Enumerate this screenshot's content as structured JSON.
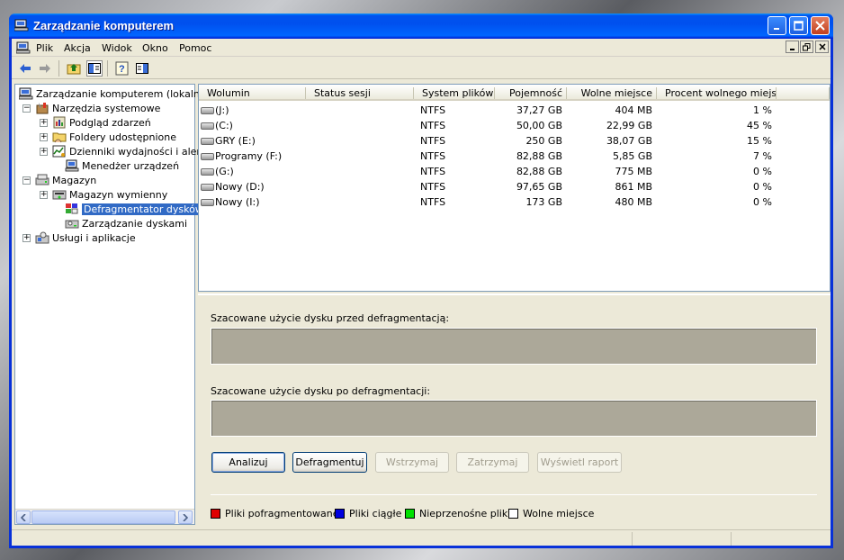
{
  "window": {
    "title": "Zarządzanie komputerem",
    "colors": {
      "titlebar": "#0053ee",
      "selection": "#316ac5",
      "frame": "#ece9d8"
    }
  },
  "menu": {
    "items": [
      "Plik",
      "Akcja",
      "Widok",
      "Okno",
      "Pomoc"
    ]
  },
  "toolbar": {
    "icons": [
      "back-arrow-icon",
      "forward-arrow-icon",
      "up-folder-icon",
      "show-hide-tree-icon",
      "help-icon",
      "export-list-icon"
    ]
  },
  "tree": {
    "root": "Zarządzanie komputerem (lokalne)",
    "nodes": [
      {
        "label": "Narzędzia systemowe",
        "level": 1,
        "expander": "−",
        "icon": "tools-icon"
      },
      {
        "label": "Podgląd zdarzeń",
        "level": 2,
        "expander": "+",
        "icon": "event-viewer-icon"
      },
      {
        "label": "Foldery udostępnione",
        "level": 2,
        "expander": "+",
        "icon": "shared-folder-icon"
      },
      {
        "label": "Dzienniki wydajności i alerty",
        "level": 2,
        "expander": "+",
        "icon": "performance-icon"
      },
      {
        "label": "Menedżer urządzeń",
        "level": 2,
        "expander": "",
        "icon": "device-manager-icon"
      },
      {
        "label": "Magazyn",
        "level": 1,
        "expander": "−",
        "icon": "storage-icon"
      },
      {
        "label": "Magazyn wymienny",
        "level": 2,
        "expander": "+",
        "icon": "removable-storage-icon"
      },
      {
        "label": "Defragmentator dysków",
        "level": 2,
        "expander": "",
        "icon": "defrag-icon",
        "selected": true
      },
      {
        "label": "Zarządzanie dyskami",
        "level": 2,
        "expander": "",
        "icon": "disk-management-icon"
      },
      {
        "label": "Usługi i aplikacje",
        "level": 1,
        "expander": "+",
        "icon": "services-icon"
      }
    ]
  },
  "volumes": {
    "columns": [
      "Wolumin",
      "Status sesji",
      "System plików",
      "Pojemność",
      "Wolne miejsce",
      "Procent wolnego miejsca"
    ],
    "rows": [
      {
        "name": "(J:)",
        "status": "",
        "fs": "NTFS",
        "capacity": "37,27 GB",
        "free": "404 MB",
        "percent": "1 %"
      },
      {
        "name": "(C:)",
        "status": "",
        "fs": "NTFS",
        "capacity": "50,00 GB",
        "free": "22,99 GB",
        "percent": "45 %"
      },
      {
        "name": "GRY (E:)",
        "status": "",
        "fs": "NTFS",
        "capacity": "250 GB",
        "free": "38,07 GB",
        "percent": "15 %"
      },
      {
        "name": "Programy (F:)",
        "status": "",
        "fs": "NTFS",
        "capacity": "82,88 GB",
        "free": "5,85 GB",
        "percent": "7 %"
      },
      {
        "name": "(G:)",
        "status": "",
        "fs": "NTFS",
        "capacity": "82,88 GB",
        "free": "775 MB",
        "percent": "0 %"
      },
      {
        "name": "Nowy (D:)",
        "status": "",
        "fs": "NTFS",
        "capacity": "97,65 GB",
        "free": "861 MB",
        "percent": "0 %"
      },
      {
        "name": "Nowy (I:)",
        "status": "",
        "fs": "NTFS",
        "capacity": "173 GB",
        "free": "480 MB",
        "percent": "0 %"
      }
    ]
  },
  "defrag": {
    "before_label": "Szacowane użycie dysku przed defragmentacją:",
    "after_label": "Szacowane użycie dysku po defragmentacji:",
    "bar_color": "#aca899",
    "buttons": [
      {
        "label": "Analizuj",
        "enabled": true
      },
      {
        "label": "Defragmentuj",
        "enabled": true
      },
      {
        "label": "Wstrzymaj",
        "enabled": false
      },
      {
        "label": "Zatrzymaj",
        "enabled": false
      },
      {
        "label": "Wyświetl raport",
        "enabled": false
      }
    ],
    "legend": [
      {
        "label": "Pliki pofragmentowane",
        "color": "#e00000"
      },
      {
        "label": "Pliki ciągłe",
        "color": "#0000e0"
      },
      {
        "label": "Nieprzenośne pliki",
        "color": "#00e000"
      },
      {
        "label": "Wolne miejsce",
        "color": "#ffffff"
      }
    ]
  }
}
